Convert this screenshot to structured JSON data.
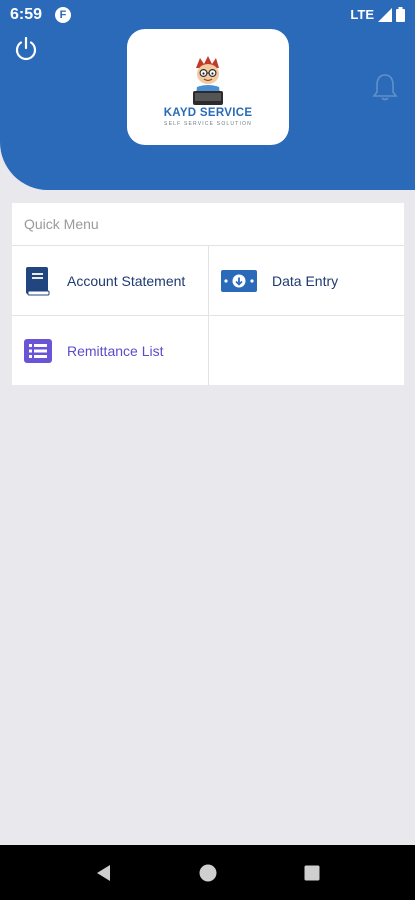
{
  "status_bar": {
    "time": "6:59",
    "app_icon_glyph": "F",
    "network": "LTE"
  },
  "header": {
    "power_icon": "power-icon",
    "bell_icon": "bell-icon",
    "logo": {
      "name": "KAYD SERVICE",
      "tagline": "SELF SERVICE SOLUTION"
    }
  },
  "quick_menu": {
    "title": "Quick Menu",
    "items": [
      {
        "label": "Account Statement",
        "icon": "book-icon"
      },
      {
        "label": "Data Entry",
        "icon": "money-download-icon"
      },
      {
        "label": "Remittance List",
        "icon": "list-icon"
      }
    ]
  },
  "nav": {
    "back": "back-icon",
    "home": "home-icon",
    "recents": "recents-icon"
  },
  "colors": {
    "header": "#2a6ab8",
    "navy_text": "#1f3a70",
    "purple": "#5b4cc9",
    "background": "#e8e8ed"
  }
}
